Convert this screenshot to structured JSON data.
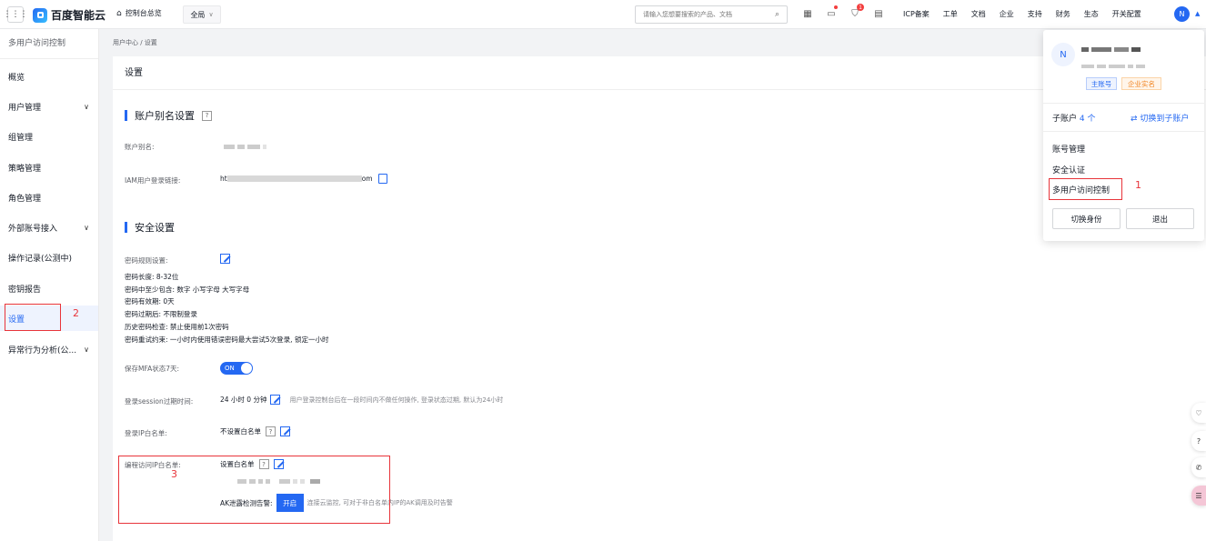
{
  "topbar": {
    "grid_icon": "grid-icon",
    "logo_text": "百度智能云",
    "console_home": "控制台总览",
    "region": "全局",
    "search_placeholder": "请输入您想要搜索的产品、文档",
    "cart_badge": "1",
    "menu": [
      "ICP备案",
      "工单",
      "文档",
      "企业",
      "支持",
      "财务",
      "生态",
      "开关配置"
    ],
    "avatar_letter": "N"
  },
  "sidebar": {
    "title": "多用户访问控制",
    "items": [
      {
        "label": "概览",
        "expandable": false
      },
      {
        "label": "用户管理",
        "expandable": true
      },
      {
        "label": "组管理",
        "expandable": false
      },
      {
        "label": "策略管理",
        "expandable": false
      },
      {
        "label": "角色管理",
        "expandable": false
      },
      {
        "label": "外部账号接入",
        "expandable": true
      },
      {
        "label": "操作记录(公测中)",
        "expandable": false
      },
      {
        "label": "密钥报告",
        "expandable": false
      },
      {
        "label": "设置",
        "expandable": false,
        "active": true
      },
      {
        "label": "异常行为分析(公...",
        "expandable": true
      }
    ]
  },
  "breadcrumb": "用户中心  /  设置",
  "page_title": "设置",
  "alias_section": {
    "title": "账户别名设置",
    "alias_label": "账户别名:",
    "iam_label": "IAM用户登录链接:",
    "iam_prefix": "ht",
    "iam_suffix": "om"
  },
  "security_section": {
    "title": "安全设置",
    "pw_rule_label": "密码规则设置:",
    "pw_lines": [
      "密码长度:   8-32位",
      "密码中至少包含:   数字 小写字母 大写字母",
      "密码有效期:   0天",
      "密码过期后:   不限制登录",
      "历史密码检查:   禁止使用前1次密码",
      "密码重试约束:   一小时内使用错误密码最大尝试5次登录, 锁定一小时"
    ],
    "mfa_label": "保存MFA状态7天:",
    "mfa_toggle": "ON",
    "session_label": "登录session过期时间:",
    "session_value": "24 小时 0 分钟",
    "session_hint": "用户登录控制台后在一段时间内不做任何操作, 登录状态过期, 默认为24小时",
    "ip_label": "登录IP白名单:",
    "ip_value": "不设置白名单",
    "prog_label": "编程访问IP白名单:",
    "prog_value": "设置白名单",
    "ak_label": "AK泄露检测告警:",
    "ak_button": "开启",
    "ak_hint": "连接云监控, 可对于非白名单内IP的AK调用及时告警"
  },
  "annotations": [
    "1",
    "2",
    "3"
  ],
  "popup": {
    "avatar_letter": "N",
    "tag_main": "主账号",
    "tag_enterprise": "企业实名",
    "sub_label": "子账户",
    "sub_count": "4 个",
    "switch_sub": "切换到子账户",
    "links": [
      "账号管理",
      "安全认证",
      "多用户访问控制"
    ],
    "switch_identity": "切换身份",
    "logout": "退出"
  },
  "colors": {
    "brand": "#2468f2",
    "annotation": "#e8343a"
  }
}
